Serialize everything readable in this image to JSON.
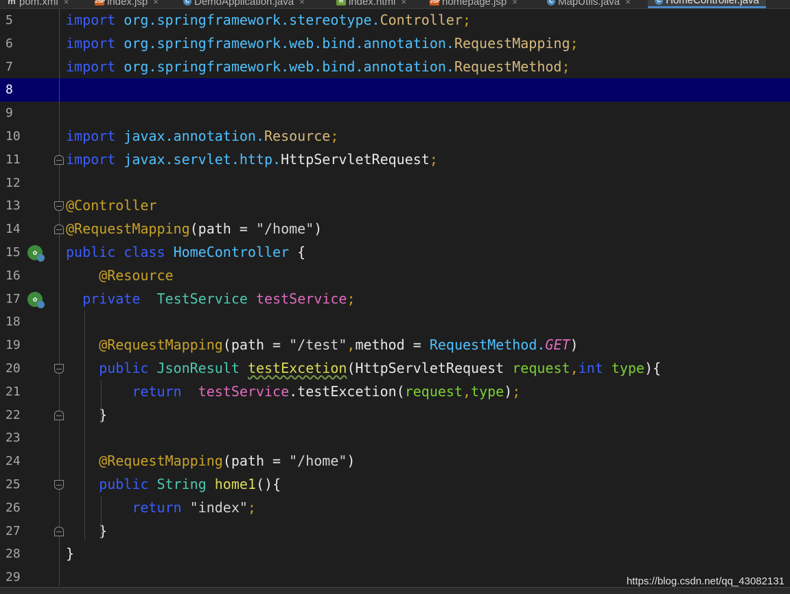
{
  "tabs": [
    {
      "icon": "maven-icon",
      "glyph": "m",
      "label": "pom.xml"
    },
    {
      "icon": "jsp-file-icon",
      "glyph": "JSP",
      "label": "index.jsp"
    },
    {
      "icon": "java-class-icon",
      "glyph": "C",
      "label": "DemoApplication.java"
    },
    {
      "icon": "html-file-icon",
      "glyph": "H",
      "label": "index.html"
    },
    {
      "icon": "jsp-file-icon",
      "glyph": "JSP",
      "label": "homepage.jsp"
    },
    {
      "icon": "java-class-icon",
      "glyph": "C",
      "label": "MapUtils.java"
    },
    {
      "icon": "java-class-icon",
      "glyph": "C",
      "label": "HomeController.java",
      "active": true
    }
  ],
  "close_glyph": "×",
  "editor": {
    "current_line": 8,
    "lines": [
      {
        "n": "5",
        "tokens": [
          [
            "kw",
            "import"
          ],
          [
            "plain",
            " "
          ],
          [
            "pkg",
            "org.springframework.stereotype."
          ],
          [
            "cls",
            "Controller"
          ],
          [
            "ann",
            ";"
          ]
        ]
      },
      {
        "n": "6",
        "tokens": [
          [
            "kw",
            "import"
          ],
          [
            "plain",
            " "
          ],
          [
            "pkg",
            "org.springframework.web.bind.annotation."
          ],
          [
            "cls",
            "RequestMapping"
          ],
          [
            "ann",
            ";"
          ]
        ]
      },
      {
        "n": "7",
        "tokens": [
          [
            "kw",
            "import"
          ],
          [
            "plain",
            " "
          ],
          [
            "pkg",
            "org.springframework.web.bind.annotation."
          ],
          [
            "cls",
            "RequestMethod"
          ],
          [
            "ann",
            ";"
          ]
        ]
      },
      {
        "n": "8",
        "tokens": []
      },
      {
        "n": "9",
        "tokens": []
      },
      {
        "n": "10",
        "tokens": [
          [
            "kw",
            "import"
          ],
          [
            "plain",
            " "
          ],
          [
            "pkg",
            "javax.annotation."
          ],
          [
            "cls",
            "Resource"
          ],
          [
            "ann",
            ";"
          ]
        ]
      },
      {
        "n": "11",
        "tokens": [
          [
            "kw",
            "import"
          ],
          [
            "plain",
            " "
          ],
          [
            "pkg",
            "javax.servlet.http."
          ],
          [
            "plain",
            "HttpServletRequest"
          ],
          [
            "ann",
            ";"
          ]
        ]
      },
      {
        "n": "12",
        "tokens": []
      },
      {
        "n": "13",
        "tokens": [
          [
            "ann",
            "@Controller"
          ]
        ]
      },
      {
        "n": "14",
        "tokens": [
          [
            "ann",
            "@RequestMapping"
          ],
          [
            "plain",
            "(path = "
          ],
          [
            "str",
            "\"/home\""
          ],
          [
            "plain",
            ")"
          ]
        ]
      },
      {
        "n": "15",
        "tokens": [
          [
            "kw",
            "public"
          ],
          [
            "plain",
            " "
          ],
          [
            "kw",
            "class"
          ],
          [
            "plain",
            " "
          ],
          [
            "pkg",
            "HomeController"
          ],
          [
            "plain",
            " {"
          ]
        ]
      },
      {
        "n": "16",
        "tokens": [
          [
            "plain",
            "    "
          ],
          [
            "ann",
            "@Resource"
          ]
        ]
      },
      {
        "n": "17",
        "tokens": [
          [
            "plain",
            "  "
          ],
          [
            "kw",
            "private"
          ],
          [
            "plain",
            "  "
          ],
          [
            "type",
            "TestService"
          ],
          [
            "plain",
            " "
          ],
          [
            "field",
            "testService"
          ],
          [
            "ann",
            ";"
          ]
        ]
      },
      {
        "n": "18",
        "tokens": []
      },
      {
        "n": "19",
        "tokens": [
          [
            "plain",
            "    "
          ],
          [
            "ann",
            "@RequestMapping"
          ],
          [
            "plain",
            "(path = "
          ],
          [
            "str",
            "\"/test\""
          ],
          [
            "ann",
            ","
          ],
          [
            "plain",
            "method = "
          ],
          [
            "pkg",
            "RequestMethod."
          ],
          [
            "italic",
            "GET"
          ],
          [
            "plain",
            ")"
          ]
        ]
      },
      {
        "n": "20",
        "tokens": [
          [
            "plain",
            "    "
          ],
          [
            "kw",
            "public"
          ],
          [
            "plain",
            " "
          ],
          [
            "type",
            "JsonResult"
          ],
          [
            "plain",
            " "
          ],
          [
            "meth",
            "testExcetion"
          ],
          [
            "plain",
            "(HttpServletRequest "
          ],
          [
            "param",
            "request"
          ],
          [
            "ann",
            ","
          ],
          [
            "kw",
            "int"
          ],
          [
            "plain",
            " "
          ],
          [
            "param",
            "type"
          ],
          [
            "plain",
            "){"
          ]
        ]
      },
      {
        "n": "21",
        "tokens": [
          [
            "plain",
            "        "
          ],
          [
            "kw",
            "return"
          ],
          [
            "plain",
            "  "
          ],
          [
            "field",
            "testService"
          ],
          [
            "plain",
            ".testExcetion("
          ],
          [
            "param",
            "request"
          ],
          [
            "ann",
            ","
          ],
          [
            "param",
            "type"
          ],
          [
            "plain",
            ")"
          ],
          [
            "ann",
            ";"
          ]
        ]
      },
      {
        "n": "22",
        "tokens": [
          [
            "plain",
            "    }"
          ]
        ]
      },
      {
        "n": "23",
        "tokens": []
      },
      {
        "n": "24",
        "tokens": [
          [
            "plain",
            "    "
          ],
          [
            "ann",
            "@RequestMapping"
          ],
          [
            "plain",
            "(path = "
          ],
          [
            "str",
            "\"/home\""
          ],
          [
            "plain",
            ")"
          ]
        ]
      },
      {
        "n": "25",
        "tokens": [
          [
            "plain",
            "    "
          ],
          [
            "kw",
            "public"
          ],
          [
            "plain",
            " "
          ],
          [
            "type",
            "String"
          ],
          [
            "plain",
            " "
          ],
          [
            "meth",
            "home1"
          ],
          [
            "plain",
            "(){"
          ]
        ]
      },
      {
        "n": "26",
        "tokens": [
          [
            "plain",
            "        "
          ],
          [
            "kw",
            "return"
          ],
          [
            "plain",
            " "
          ],
          [
            "str",
            "\"index\""
          ],
          [
            "ann",
            ";"
          ]
        ]
      },
      {
        "n": "27",
        "tokens": [
          [
            "plain",
            "    }"
          ]
        ]
      },
      {
        "n": "28",
        "tokens": [
          [
            "plain",
            "}"
          ]
        ]
      },
      {
        "n": "29",
        "tokens": []
      }
    ]
  },
  "watermark": "https://blog.csdn.net/qq_43082131"
}
